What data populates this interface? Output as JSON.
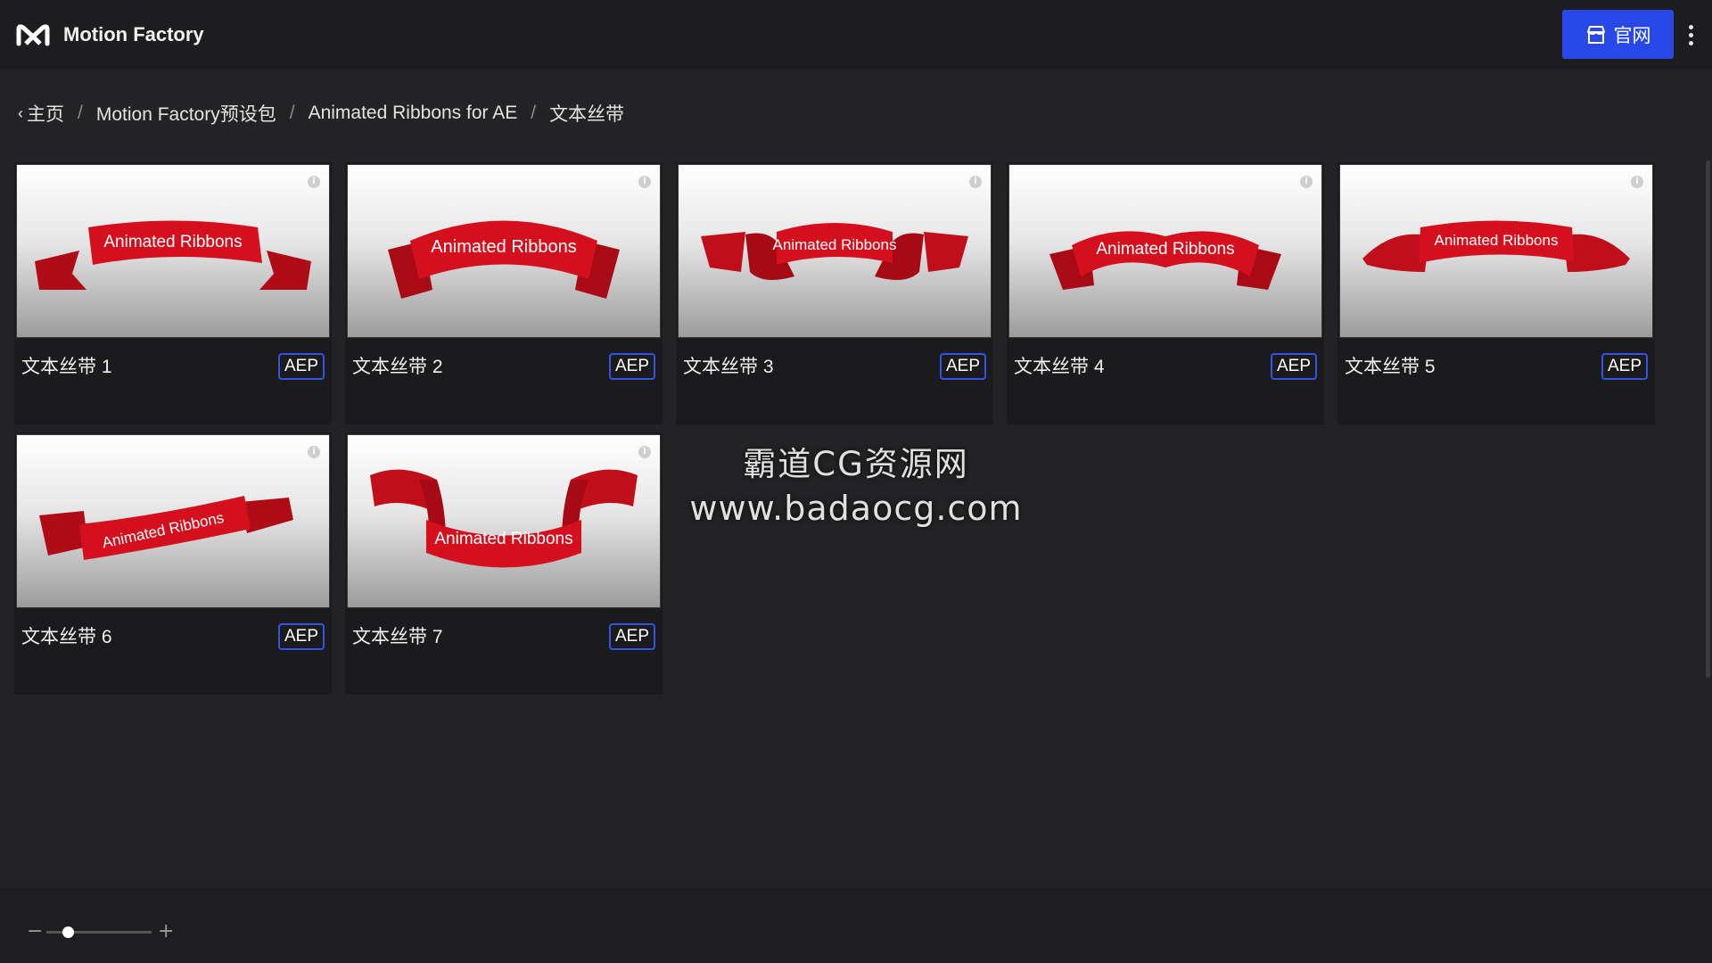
{
  "app": {
    "title": "Motion Factory",
    "site_button_label": "官网"
  },
  "breadcrumb": {
    "back_symbol": "‹",
    "items": [
      "主页",
      "Motion Factory预设包",
      "Animated Ribbons for AE",
      "文本丝带"
    ],
    "separator": "/"
  },
  "cards": [
    {
      "title": "文本丝带 1",
      "badge": "AEP",
      "thumb_text": "Animated Ribbons"
    },
    {
      "title": "文本丝带 2",
      "badge": "AEP",
      "thumb_text": "Animated Ribbons"
    },
    {
      "title": "文本丝带 3",
      "badge": "AEP",
      "thumb_text": "Animated Ribbons"
    },
    {
      "title": "文本丝带 4",
      "badge": "AEP",
      "thumb_text": "Animated Ribbons"
    },
    {
      "title": "文本丝带 5",
      "badge": "AEP",
      "thumb_text": "Animated Ribbons"
    },
    {
      "title": "文本丝带 6",
      "badge": "AEP",
      "thumb_text": "Animated Ribbons"
    },
    {
      "title": "文本丝带 7",
      "badge": "AEP",
      "thumb_text": "Animated Ribbons"
    }
  ],
  "watermark": {
    "line1": "霸道CG资源网",
    "line2": "www.badaocg.com"
  },
  "zoom": {
    "minus": "−",
    "plus": "+",
    "level": 0.2
  },
  "icons": {
    "logo": "motion-factory-logo-icon",
    "site": "storefront-icon",
    "more": "more-vertical-icon",
    "info": "info-icon"
  },
  "colors": {
    "accent": "#2848e8",
    "ribbon": "#d4101e",
    "background": "#232325"
  }
}
